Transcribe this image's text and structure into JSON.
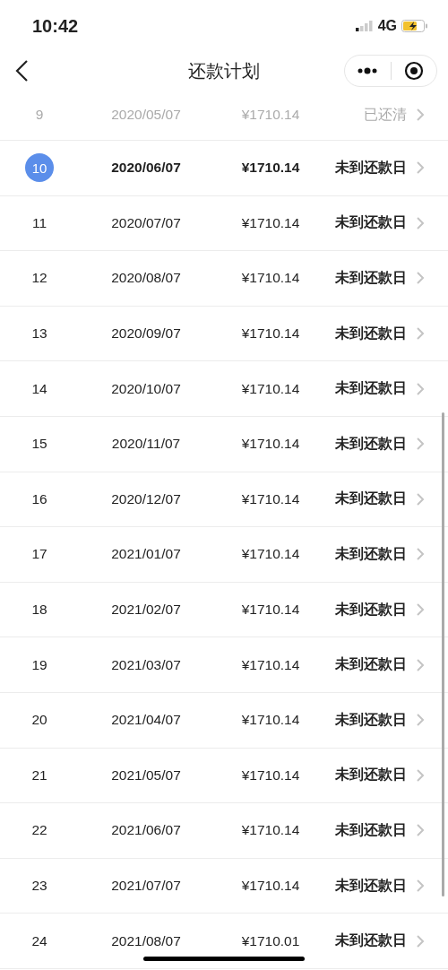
{
  "status_bar": {
    "time": "10:42",
    "network": "4G"
  },
  "nav": {
    "title": "还款计划"
  },
  "rows": [
    {
      "index": "9",
      "date": "2020/05/07",
      "amount": "¥1710.14",
      "status": "已还清",
      "kind": "paid"
    },
    {
      "index": "10",
      "date": "2020/06/07",
      "amount": "¥1710.14",
      "status": "未到还款日",
      "kind": "current"
    },
    {
      "index": "11",
      "date": "2020/07/07",
      "amount": "¥1710.14",
      "status": "未到还款日",
      "kind": "upcoming"
    },
    {
      "index": "12",
      "date": "2020/08/07",
      "amount": "¥1710.14",
      "status": "未到还款日",
      "kind": "upcoming"
    },
    {
      "index": "13",
      "date": "2020/09/07",
      "amount": "¥1710.14",
      "status": "未到还款日",
      "kind": "upcoming"
    },
    {
      "index": "14",
      "date": "2020/10/07",
      "amount": "¥1710.14",
      "status": "未到还款日",
      "kind": "upcoming"
    },
    {
      "index": "15",
      "date": "2020/11/07",
      "amount": "¥1710.14",
      "status": "未到还款日",
      "kind": "upcoming"
    },
    {
      "index": "16",
      "date": "2020/12/07",
      "amount": "¥1710.14",
      "status": "未到还款日",
      "kind": "upcoming"
    },
    {
      "index": "17",
      "date": "2021/01/07",
      "amount": "¥1710.14",
      "status": "未到还款日",
      "kind": "upcoming"
    },
    {
      "index": "18",
      "date": "2021/02/07",
      "amount": "¥1710.14",
      "status": "未到还款日",
      "kind": "upcoming"
    },
    {
      "index": "19",
      "date": "2021/03/07",
      "amount": "¥1710.14",
      "status": "未到还款日",
      "kind": "upcoming"
    },
    {
      "index": "20",
      "date": "2021/04/07",
      "amount": "¥1710.14",
      "status": "未到还款日",
      "kind": "upcoming"
    },
    {
      "index": "21",
      "date": "2021/05/07",
      "amount": "¥1710.14",
      "status": "未到还款日",
      "kind": "upcoming"
    },
    {
      "index": "22",
      "date": "2021/06/07",
      "amount": "¥1710.14",
      "status": "未到还款日",
      "kind": "upcoming"
    },
    {
      "index": "23",
      "date": "2021/07/07",
      "amount": "¥1710.14",
      "status": "未到还款日",
      "kind": "upcoming"
    },
    {
      "index": "24",
      "date": "2021/08/07",
      "amount": "¥1710.01",
      "status": "未到还款日",
      "kind": "upcoming"
    }
  ]
}
